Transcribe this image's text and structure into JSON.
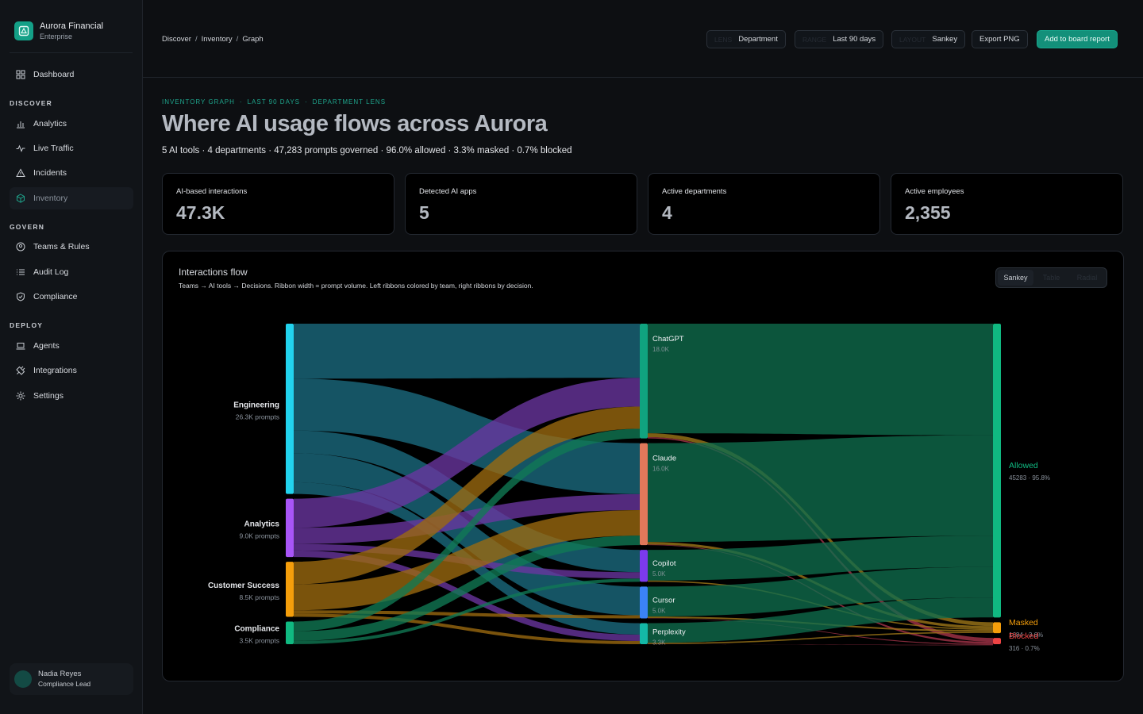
{
  "brand": {
    "name": "Aurora Financial",
    "tier": "Enterprise"
  },
  "nav": {
    "dashboard": "Dashboard",
    "sections": {
      "discover": "DISCOVER",
      "govern": "GOVERN",
      "deploy": "DEPLOY"
    },
    "items": {
      "analytics": "Analytics",
      "live_traffic": "Live Traffic",
      "incidents": "Incidents",
      "inventory": "Inventory",
      "teams_rules": "Teams & Rules",
      "audit_log": "Audit Log",
      "compliance": "Compliance",
      "agents": "Agents",
      "integrations": "Integrations",
      "settings": "Settings"
    },
    "active": "inventory"
  },
  "user": {
    "name": "Nadia Reyes",
    "role": "Compliance Lead"
  },
  "breadcrumb": [
    "Discover",
    "Inventory",
    "Graph"
  ],
  "toolbar": {
    "department": {
      "ghost": "LENS",
      "label": "Department"
    },
    "range": {
      "ghost": "RANGE",
      "label": "Last 90 days"
    },
    "layout": {
      "ghost": "LAYOUT",
      "label": "Sankey"
    },
    "export": "Export PNG",
    "add_board": "Add to board report"
  },
  "eyebrow": [
    "INVENTORY GRAPH",
    "LAST 90 DAYS",
    "DEPARTMENT LENS"
  ],
  "title": "Where AI usage flows across Aurora",
  "subtitle": "5 AI tools · 4 departments · 47,283 prompts governed · 96.0% allowed · 3.3% masked · 0.7% blocked",
  "kpis": [
    {
      "label": "AI-based interactions",
      "value": "47.3K"
    },
    {
      "label": "Detected AI apps",
      "value": "5"
    },
    {
      "label": "Active departments",
      "value": "4"
    },
    {
      "label": "Active employees",
      "value": "2,355"
    }
  ],
  "flow_panel": {
    "title": "Interactions flow",
    "subtitle": "Teams → AI tools → Decisions.  Ribbon width = prompt volume.  Left ribbons colored by team, right ribbons by decision.",
    "views": [
      "Sankey",
      "Table",
      "Radial"
    ],
    "active_view": "Sankey"
  },
  "colors": {
    "accent": "#13907a",
    "engineering": "#22d3ee",
    "analytics": "#a855f7",
    "customer_success": "#f59e0b",
    "compliance": "#10b981",
    "chatgpt": "#10a37f",
    "claude": "#e0785a",
    "copilot": "#7c3aed",
    "cursor": "#3b82f6",
    "perplexity": "#14b8a6",
    "allowed": "#10b981",
    "masked": "#f59e0b",
    "blocked": "#ef4444"
  },
  "sankey": {
    "teams": [
      {
        "id": "eng",
        "name": "Engineering",
        "sub": "26.3K prompts",
        "value": 26.3,
        "color": "#22d3ee",
        "ribbon": "#1b6c80"
      },
      {
        "id": "ana",
        "name": "Analytics",
        "sub": "9.0K prompts",
        "value": 9.0,
        "color": "#a855f7",
        "ribbon": "#6a36a0"
      },
      {
        "id": "cs",
        "name": "Customer Success",
        "sub": "8.5K prompts",
        "value": 8.5,
        "color": "#f59e0b",
        "ribbon": "#9c6a10"
      },
      {
        "id": "com",
        "name": "Compliance",
        "sub": "3.5K prompts",
        "value": 3.5,
        "color": "#10b981",
        "ribbon": "#117a55"
      }
    ],
    "tools": [
      {
        "id": "gpt",
        "name": "ChatGPT",
        "sub": "18.0K",
        "value": 18.0,
        "color": "#10a37f"
      },
      {
        "id": "cla",
        "name": "Claude",
        "sub": "16.0K",
        "value": 16.0,
        "color": "#e0785a"
      },
      {
        "id": "cop",
        "name": "Copilot",
        "sub": "5.0K",
        "value": 5.0,
        "color": "#7c3aed"
      },
      {
        "id": "cur",
        "name": "Cursor",
        "sub": "5.0K",
        "value": 5.0,
        "color": "#3b82f6"
      },
      {
        "id": "per",
        "name": "Perplexity",
        "sub": "3.3K",
        "value": 3.3,
        "color": "#14b8a6"
      }
    ],
    "decisions": [
      {
        "id": "allow",
        "name": "Allowed",
        "sub": "45283 · 95.8%",
        "value": 45.283,
        "color": "#10b981",
        "ribbon": "#0f6d4d"
      },
      {
        "id": "mask",
        "name": "Masked",
        "sub": "1684 · 3.6%",
        "value": 1.684,
        "color": "#f59e0b",
        "ribbon": "#a07818"
      },
      {
        "id": "block",
        "name": "Blocked",
        "sub": "316 · 0.7%",
        "value": 0.316,
        "color": "#ef4444",
        "ribbon": "#a8344a"
      }
    ],
    "team_tool_links": [
      [
        "eng",
        "gpt",
        8.5
      ],
      [
        "eng",
        "cla",
        8.0
      ],
      [
        "eng",
        "cop",
        3.5
      ],
      [
        "eng",
        "cur",
        4.5
      ],
      [
        "eng",
        "per",
        1.8
      ],
      [
        "ana",
        "gpt",
        4.5
      ],
      [
        "ana",
        "cla",
        2.5
      ],
      [
        "ana",
        "cop",
        1.0
      ],
      [
        "ana",
        "per",
        1.0
      ],
      [
        "cs",
        "gpt",
        3.5
      ],
      [
        "cs",
        "cla",
        4.0
      ],
      [
        "cs",
        "cur",
        0.5
      ],
      [
        "cs",
        "per",
        0.5
      ],
      [
        "com",
        "gpt",
        1.5
      ],
      [
        "com",
        "cla",
        1.5
      ],
      [
        "com",
        "cop",
        0.5
      ]
    ],
    "tool_decision_links": [
      [
        "gpt",
        "allow",
        17.2
      ],
      [
        "gpt",
        "mask",
        0.6
      ],
      [
        "gpt",
        "block",
        0.2
      ],
      [
        "cla",
        "allow",
        15.5
      ],
      [
        "cla",
        "mask",
        0.4
      ],
      [
        "cla",
        "block",
        0.1
      ],
      [
        "cop",
        "allow",
        4.8
      ],
      [
        "cop",
        "mask",
        0.2
      ],
      [
        "cur",
        "allow",
        4.7
      ],
      [
        "cur",
        "mask",
        0.25
      ],
      [
        "cur",
        "block",
        0.05
      ],
      [
        "per",
        "allow",
        3.08
      ],
      [
        "per",
        "mask",
        0.2
      ],
      [
        "per",
        "block",
        0.02
      ]
    ]
  }
}
